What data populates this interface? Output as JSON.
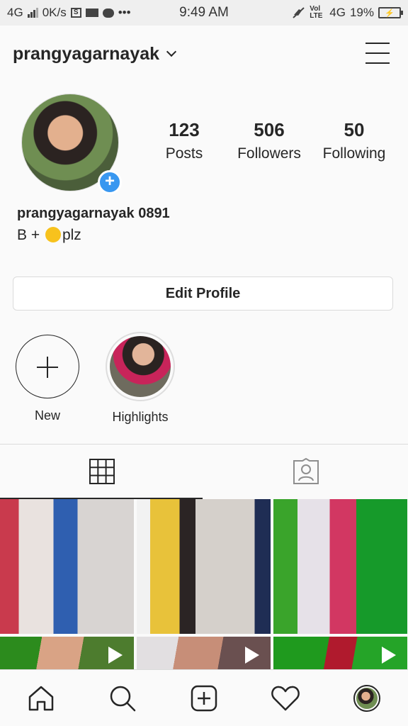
{
  "status_bar": {
    "network": "4G",
    "speed": "0K/s",
    "time": "9:49 AM",
    "volte": "Vol LTE",
    "network_right": "4G",
    "battery": "19%",
    "icons": [
      "signal-icon",
      "s-app-icon",
      "video-icon",
      "message-icon",
      "more-icon",
      "mute-icon",
      "battery-icon"
    ]
  },
  "header": {
    "username": "prangyagarnayak",
    "icons": [
      "chevron-down-icon",
      "menu-icon"
    ]
  },
  "profile": {
    "stats": [
      {
        "value": "123",
        "label": "Posts"
      },
      {
        "value": "506",
        "label": "Followers"
      },
      {
        "value": "50",
        "label": "Following"
      }
    ],
    "full_name": "prangyagarnayak 0891",
    "bio_prefix": "B + ",
    "bio_suffix": "plz",
    "add_story_badge": "+"
  },
  "edit_button": "Edit Profile",
  "highlights": [
    {
      "label": "New",
      "icon": "plus-icon"
    },
    {
      "label": "Highlights",
      "icon": "highlight-cover"
    }
  ],
  "tabs": [
    {
      "name": "grid",
      "icon": "grid-icon",
      "active": true
    },
    {
      "name": "tagged",
      "icon": "tagged-icon",
      "active": false
    }
  ],
  "grid_posts": [
    {
      "type": "photo"
    },
    {
      "type": "photo"
    },
    {
      "type": "photo"
    },
    {
      "type": "video"
    },
    {
      "type": "video"
    },
    {
      "type": "video"
    }
  ],
  "bottom_nav": [
    "home-icon",
    "search-icon",
    "add-post-icon",
    "heart-icon",
    "profile-avatar"
  ],
  "colors": {
    "accent": "#3897f0",
    "text": "#262626",
    "border": "#dbdbdb",
    "background": "#fafafa"
  }
}
